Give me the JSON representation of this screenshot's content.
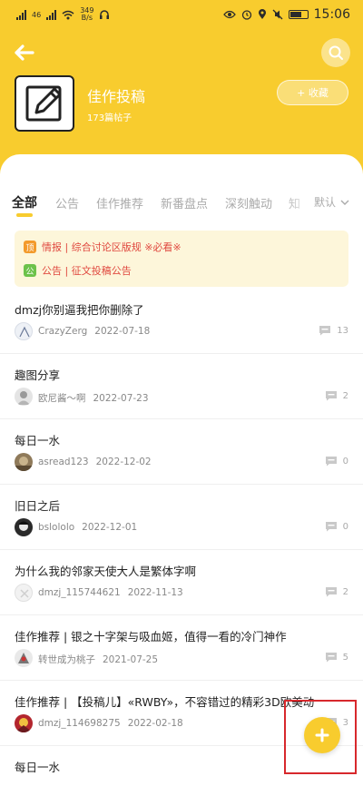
{
  "status_bar": {
    "network": "46",
    "speed_value": "349",
    "speed_unit": "B/s",
    "time": "15:06"
  },
  "board": {
    "title": "佳作投稿",
    "post_count": "173篇帖子",
    "follow_label": "+ 收藏"
  },
  "tabs": [
    "全部",
    "公告",
    "佳作推荐",
    "新番盘点",
    "深刻触动",
    "知"
  ],
  "sort_label": "默认",
  "notices": [
    {
      "tag": "顶",
      "tag_color": "#F39A2B",
      "text": "情报 | 综合讨论区版规 ※必看※"
    },
    {
      "tag": "公",
      "tag_color": "#6CC24A",
      "text": "公告 | 征文投稿公告"
    }
  ],
  "posts": [
    {
      "title": "dmzj你别逼我把你删除了",
      "author": "CrazyZerg",
      "date": "2022-07-18",
      "comments": "13"
    },
    {
      "title": "趣图分享",
      "author": "欧尼酱～啊",
      "date": "2022-07-23",
      "comments": "2"
    },
    {
      "title": "每日一水",
      "author": "asread123",
      "date": "2022-12-02",
      "comments": "0"
    },
    {
      "title": "旧日之后",
      "author": "bslololo",
      "date": "2022-12-01",
      "comments": "0"
    },
    {
      "title": "为什么我的邻家天使大人是繁体字啊",
      "author": "dmzj_115744621",
      "date": "2022-11-13",
      "comments": "2"
    },
    {
      "title": "佳作推荐 | 银之十字架与吸血姬，值得一看的冷门神作",
      "author": "转世成为桃子",
      "date": "2021-07-25",
      "comments": "5"
    },
    {
      "title": "佳作推荐 | 【投稿儿】«RWBY»，不容错过的精彩3D欧美动画",
      "author": "dmzj_114698275",
      "date": "2022-02-18",
      "comments": "3"
    },
    {
      "title": "每日一水",
      "author": "",
      "date": "",
      "comments": ""
    }
  ],
  "colors": {
    "accent": "#F8CC2E",
    "notice_text": "#E0483F",
    "highlight_box": "#D7282C"
  }
}
